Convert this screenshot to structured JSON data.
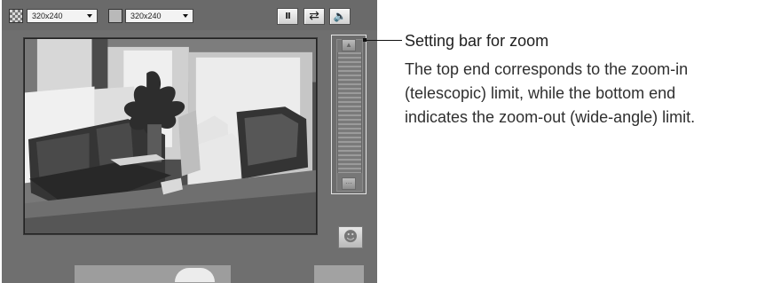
{
  "toolbar": {
    "resolution_selects": [
      {
        "value": "320x240"
      },
      {
        "value": "320x240"
      }
    ],
    "controls": {
      "pause_icon": "pause-icon",
      "swap_icon": "swap-icon",
      "sound_icon": "speaker-icon"
    }
  },
  "zoom": {
    "top_icon": "zoom-in-icon",
    "bottom_icon": "zoom-out-icon"
  },
  "annotation": {
    "title": "Setting bar for zoom",
    "description": "The top end corresponds to the zoom-in\n(telescopic) limit, while the bottom end\nindicates the zoom-out (wide-angle) limit."
  }
}
